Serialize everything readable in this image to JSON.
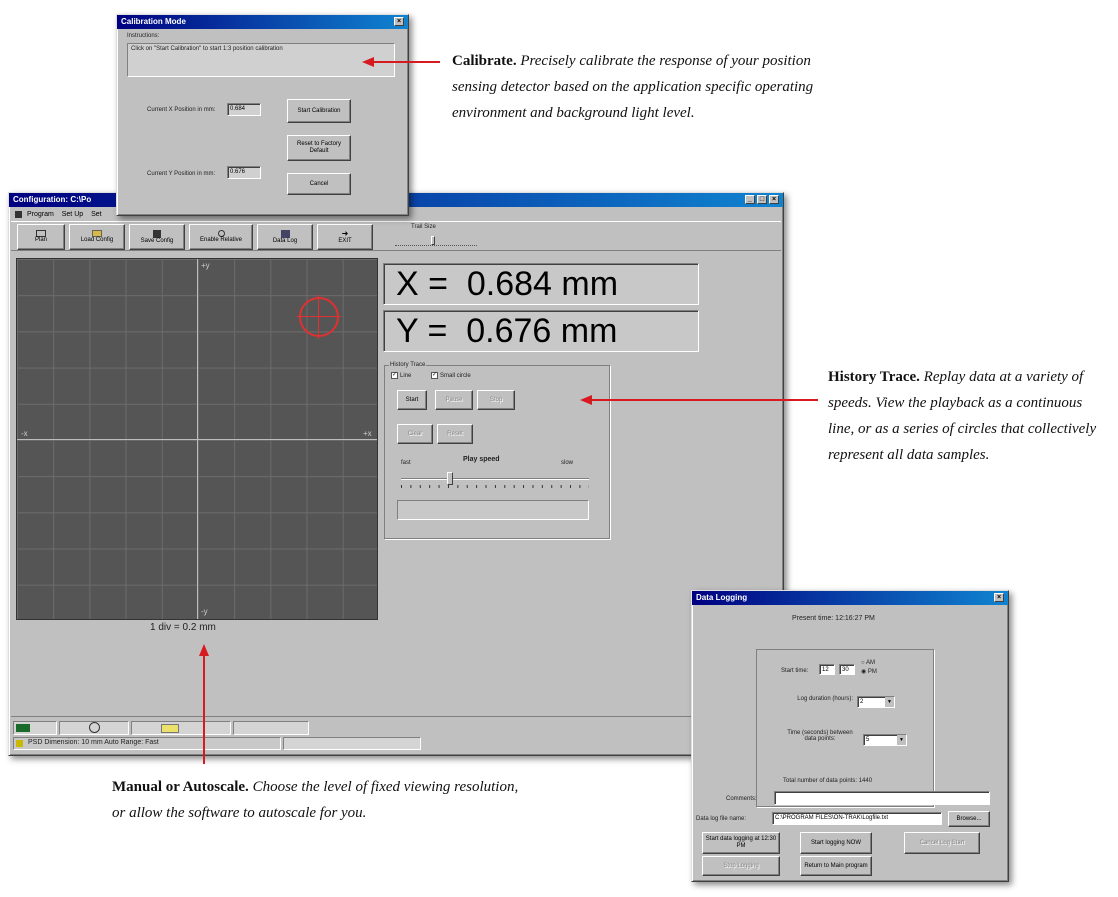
{
  "calibration_dialog": {
    "title": "Calibration Mode",
    "instructions_label": "Instructions:",
    "instructions_text": "Click on \"Start Calibration\" to start 1:3 position calibration",
    "x_label": "Current X Position in mm:",
    "x_value": "0.684",
    "y_label": "Current Y Position in mm:",
    "y_value": "0.676",
    "start_button": "Start Calibration",
    "reset_button": "Reset to Factory Default",
    "cancel_button": "Cancel"
  },
  "main_window": {
    "title": "Configuration: C:\\Po",
    "menu": [
      "Program",
      "Set Up",
      "Set"
    ],
    "toolbar": [
      "Plan",
      "Load Config",
      "Save Config",
      "Enable Relative",
      "Data Log",
      "EXIT"
    ],
    "slider_label": "Trail Size",
    "plot": {
      "axis_top": "+y",
      "axis_bottom": "-y",
      "axis_left": "-x",
      "axis_right": "+x",
      "scale_text": "1 div = 0.2 mm"
    },
    "x_readout": "X =  0.684 mm",
    "y_readout": "Y =  0.676 mm",
    "history_trace": {
      "group_label": "History Trace",
      "line_checkbox": "Line",
      "small_circle_checkbox": "Small circle",
      "buttons": [
        "Start",
        "Pause",
        "Stop",
        "Clear",
        "Reset"
      ],
      "play_speed_label": "Play speed",
      "fast_label": "fast",
      "slow_label": "slow"
    },
    "status_text": "PSD Dimension: 10 mm  Auto Range: Fast"
  },
  "data_logging": {
    "title": "Data Logging",
    "present_time": "Present time: 12:16:27 PM",
    "start_time_label": "Start time:",
    "start_hour": "12",
    "start_min": "30",
    "am_label": "AM",
    "pm_label": "PM",
    "log_duration_label": "Log duration (hours):",
    "log_duration_value": "2",
    "interval_label": "Time (seconds) between data points:",
    "interval_value": "5",
    "total_points": "Total number of data points: 1440",
    "comments_label": "Comments:",
    "comments_value": "",
    "file_label": "Data log file name:",
    "file_value": "C:\\PROGRAM FILES\\ON-TRAK\\Logfile.txt",
    "browse_button": "Browse...",
    "start_at_button": "Start data logging at 12:30 PM",
    "start_now_button": "Start logging NOW",
    "cancel_log_button": "Cancel Log Start",
    "stop_button": "Stop Logging",
    "return_button": "Return to Main program"
  },
  "annotations": {
    "calibrate_title": "Calibrate.",
    "calibrate_text": "Precisely calibrate the response of your position sensing detector based on the application specific operating environment and background light level.",
    "history_title": "History Trace.",
    "history_text": "Replay data at a variety of speeds. View the playback as a continuous line, or as a series of circles that collectively represent all data samples.",
    "autoscale_title": "Manual or Autoscale.",
    "autoscale_text": "Choose the level of fixed viewing resolution, or allow the software to autoscale for you."
  },
  "colors": {
    "annotation_arrow": "#d71920",
    "plot_background": "#555555",
    "target_marker": "#e03030",
    "titlebar": "#000080"
  }
}
